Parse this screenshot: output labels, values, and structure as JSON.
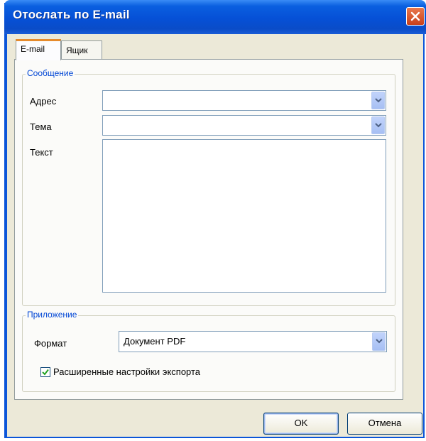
{
  "window": {
    "title": "Отослать по E-mail"
  },
  "tabs": [
    {
      "label": "E-mail",
      "active": true
    },
    {
      "label": "Ящик",
      "active": false
    }
  ],
  "message_group": {
    "title": "Сообщение",
    "address_label": "Адрес",
    "address_value": "",
    "subject_label": "Тема",
    "subject_value": "",
    "text_label": "Текст",
    "text_value": ""
  },
  "attachment_group": {
    "title": "Приложение",
    "format_label": "Формат",
    "format_value": "Документ PDF",
    "advanced_export_label": "Расширенные настройки экспорта",
    "advanced_export_checked": true
  },
  "buttons": {
    "ok_label": "OK",
    "cancel_label": "Отмена"
  },
  "icons": {
    "close": "close-icon",
    "dropdown": "chevron-down-icon",
    "check": "checkmark-icon"
  },
  "colors": {
    "titlebar": "#0650d6",
    "group_title": "#0046d5",
    "active_tab_accent": "#e68b2c",
    "close_button": "#c9401a"
  }
}
